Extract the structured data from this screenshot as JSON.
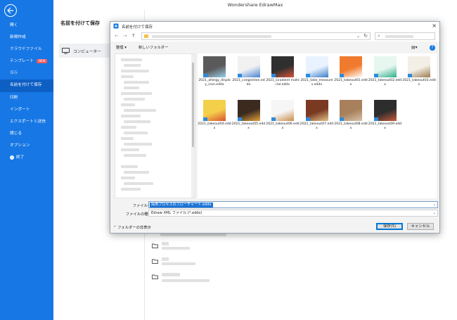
{
  "app": {
    "title": "Wondershare EdrawMax"
  },
  "sidebar": {
    "items": [
      {
        "label": "開く",
        "active": false
      },
      {
        "label": "新規作成",
        "active": false
      },
      {
        "label": "クラウドファイル",
        "active": false
      },
      {
        "label": "テンプレート",
        "active": false,
        "badge": "NEW"
      },
      {
        "label": "保存",
        "active": false,
        "dim": true
      },
      {
        "label": "名前を付けて保存",
        "active": true
      },
      {
        "label": "印刷",
        "active": false
      },
      {
        "label": "インポート",
        "active": false
      },
      {
        "label": "エクスポートと送信",
        "active": false
      },
      {
        "label": "閉じる",
        "active": false
      },
      {
        "label": "オプション",
        "active": false
      },
      {
        "label": "終了",
        "active": false,
        "icon": "exit-icon"
      }
    ]
  },
  "middle": {
    "title": "名前を付けて保存",
    "computer_label": "コンピューター"
  },
  "dialog": {
    "title": "名前を付けて保存",
    "toolbar": {
      "organize": "整理 ▾",
      "new_folder": "新しいフォルダー"
    },
    "files": [
      {
        "name": "2021_allergy_display_icon.eddx",
        "colors": [
          "#5a5a5a",
          "#9ad0e8"
        ]
      },
      {
        "name": "2021_congestion.eddx",
        "colors": [
          "#f1f1f1",
          "#4a84d3"
        ]
      },
      {
        "name": "2021_Gradient material.eddx",
        "colors": [
          "#2f2f2f",
          "#d9543a"
        ]
      },
      {
        "name": "2021_take_measures.eddx",
        "colors": [
          "#e9f3ff",
          "#3a7cc8"
        ]
      },
      {
        "name": "2021_takeout01.eddx",
        "colors": [
          "#f07b2e",
          "#ffffff"
        ]
      },
      {
        "name": "2021_takeout02.eddx",
        "colors": [
          "#e6f7f0",
          "#2fae8a"
        ]
      },
      {
        "name": "2021_takeout03.eddx",
        "colors": [
          "#f3efe6",
          "#9c7b4f"
        ]
      },
      {
        "name": "2021_takeout04.eddx",
        "colors": [
          "#f4d04a",
          "#d9542f"
        ]
      },
      {
        "name": "2021_takeout05.eddx",
        "colors": [
          "#3b2a1f",
          "#e2a13a"
        ]
      },
      {
        "name": "2021_takeout06.eddx",
        "colors": [
          "#f6f6f6",
          "#c98d4b"
        ]
      },
      {
        "name": "2021_takeout07.eddx",
        "colors": [
          "#7a3a22",
          "#e4c28a"
        ]
      },
      {
        "name": "2021_takeout08.eddx",
        "colors": [
          "#a8805c",
          "#d7c3a8"
        ]
      },
      {
        "name": "2021_takeout09.eddx",
        "colors": [
          "#2d2d2d",
          "#c75b3c"
        ]
      }
    ],
    "filename_label": "ファイル名(N):",
    "filename_value": "採用プロセスのフローチャート.eddx",
    "filetype_label": "ファイルの種類(T):",
    "filetype_value": "Edraw XML ファイル (*.eddx)",
    "hide_folders": "フォルダーの非表示",
    "save_label": "保存(S)",
    "cancel_label": "キャンセル"
  },
  "colors": {
    "accent": "#1677e5",
    "selection": "#1b74d6"
  }
}
